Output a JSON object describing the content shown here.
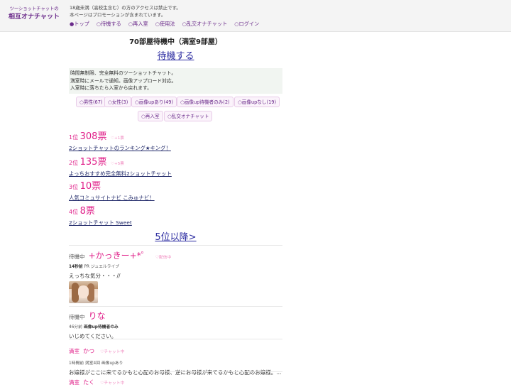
{
  "header": {
    "logo_small": "ツーショットチャットの",
    "logo_big": "相互オナチャット",
    "notice_1": "18歳未満（高校生含む）の方のアクセスは禁止です。",
    "notice_2": "本ページはプロモーションが含まれています。",
    "nav": [
      {
        "label": "●トップ"
      },
      {
        "label": "○待機する"
      },
      {
        "label": "○再入室"
      },
      {
        "label": "○使用法"
      },
      {
        "label": "○乱交オナチャット"
      },
      {
        "label": "○ログイン"
      }
    ]
  },
  "main": {
    "room_status": "70部屋待機中（満室9部屋）",
    "wait_link": "待機する",
    "info_1": "時間無制限、完全無料のツーショットチャット。",
    "info_2": "満室時にメールで通知。画像アップロード対応。",
    "info_3": "入室時に落ちたら入室から戻れます。",
    "filters": [
      {
        "label": "○男性(67)"
      },
      {
        "label": "○女性(3)"
      },
      {
        "label": "○画像upあり(49)"
      },
      {
        "label": "○画像up待機者のみ(2)"
      },
      {
        "label": "○画像upなし(19)"
      },
      {
        "label": "○再入室"
      },
      {
        "label": "○乱交オナチャット"
      }
    ],
    "ranking": [
      {
        "rank": "1位",
        "votes": "308票",
        "plus": "♡+1票",
        "site": "2ショットチャットのランキング★キング！"
      },
      {
        "rank": "2位",
        "votes": "135票",
        "plus": "♡+5票",
        "site": "よっちおすすめ完全無料2ショットチャット"
      },
      {
        "rank": "3位",
        "votes": "10票",
        "plus": "",
        "site": "人気コミュサイトナビ こみゅナビ！"
      },
      {
        "rank": "4位",
        "votes": "8票",
        "plus": "",
        "site": "2ショットチャット Sweet"
      }
    ],
    "more_link": "5位以降>",
    "posts": [
      {
        "status": "待機中",
        "name": "+かっきー+*゜",
        "badge": "♡配信中",
        "meta_time": "14秒前",
        "meta_rest": " PR ジュエルライブ",
        "msg": "えっちな気分・・・//"
      },
      {
        "status": "待機中",
        "name": "りな",
        "badge": "",
        "meta_time": "46分前",
        "meta_rest": " 画像up待機者のみ",
        "msg": "いじめてください。"
      },
      {
        "status": "満室",
        "name": "かつ",
        "badge": "♡チャット中",
        "meta_time": "1時間前",
        "meta_rest": " 満室4回 画像upあり",
        "msg": "お嬢様がここに来てるかもと心配のお母様、逆にお母様が来てるかもと心配のお嬢様。..."
      },
      {
        "status": "満室",
        "name": "たく",
        "badge": "♡チャット中",
        "meta_time": "",
        "meta_rest": "",
        "msg": ""
      }
    ]
  }
}
